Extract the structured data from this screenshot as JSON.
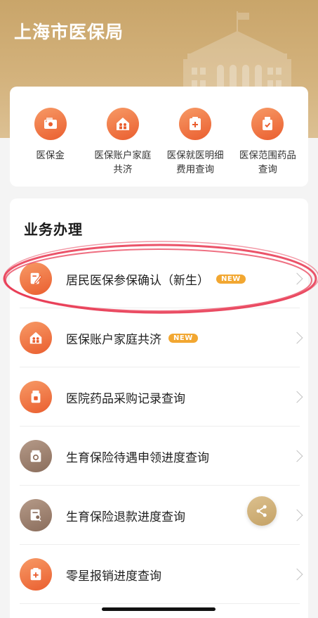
{
  "header": {
    "title": "上海市医保局"
  },
  "quick_links": [
    {
      "label": "医保金",
      "icon": "wallet-icon"
    },
    {
      "label": "医保账户家庭共济",
      "icon": "family-house-icon"
    },
    {
      "label": "医保就医明细费用查询",
      "icon": "medical-bill-icon"
    },
    {
      "label": "医保范围药品查询",
      "icon": "medicine-bottle-icon"
    }
  ],
  "services": {
    "title": "业务办理",
    "items": [
      {
        "label": "居民医保参保确认（新生）",
        "badge": "NEW",
        "icon": "edit-document-icon"
      },
      {
        "label": "医保账户家庭共济",
        "badge": "NEW",
        "icon": "family-house-icon"
      },
      {
        "label": "医院药品采购记录查询",
        "badge": "",
        "icon": "medicine-box-icon"
      },
      {
        "label": "生育保险待遇申领进度查询",
        "badge": "",
        "icon": "maternity-claim-icon"
      },
      {
        "label": "生育保险退款进度查询",
        "badge": "",
        "icon": "refund-search-icon"
      },
      {
        "label": "零星报销进度查询",
        "badge": "",
        "icon": "reimbursement-icon"
      }
    ]
  },
  "colors": {
    "brand_gold": "#c9a56a",
    "icon_orange": "#ea5e2f",
    "badge": "#f2a731",
    "annotation_red": "#e8354f"
  }
}
